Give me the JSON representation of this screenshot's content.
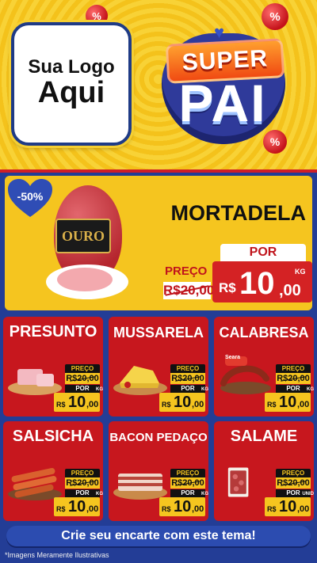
{
  "logo": {
    "line1": "Sua Logo",
    "line2": "Aqui"
  },
  "campaign": {
    "super": "SUPER",
    "pai": "PAI"
  },
  "featured": {
    "discount": "-50%",
    "brand": "OURO",
    "name": "MORTADELA",
    "preco_label": "PREÇO",
    "old_price": "R$20,00",
    "por_label": "POR",
    "currency": "R$",
    "price_int": "10",
    "price_dec": ",00",
    "unit": "KG"
  },
  "products": [
    {
      "name": "PRESUNTO",
      "preco_label": "PREÇO",
      "old_price": "R$20,00",
      "por_label": "POR",
      "currency": "R$",
      "price_int": "10",
      "price_dec": ",00",
      "unit": "KG"
    },
    {
      "name": "MUSSARELA",
      "preco_label": "PREÇO",
      "old_price": "R$20,00",
      "por_label": "POR",
      "currency": "R$",
      "price_int": "10",
      "price_dec": ",00",
      "unit": "KG"
    },
    {
      "name": "CALABRESA",
      "preco_label": "PREÇO",
      "old_price": "R$20,00",
      "por_label": "POR",
      "currency": "R$",
      "price_int": "10",
      "price_dec": ",00",
      "unit": "KG",
      "brand": "Seara"
    },
    {
      "name": "SALSICHA",
      "preco_label": "PREÇO",
      "old_price": "R$20,00",
      "por_label": "POR",
      "currency": "R$",
      "price_int": "10",
      "price_dec": ",00",
      "unit": "KG"
    },
    {
      "name": "BACON PEDAÇO",
      "preco_label": "PREÇO",
      "old_price": "R$20,00",
      "por_label": "POR",
      "currency": "R$",
      "price_int": "10",
      "price_dec": ",00",
      "unit": "KG"
    },
    {
      "name": "SALAME",
      "preco_label": "PREÇO",
      "old_price": "R$20,00",
      "por_label": "POR",
      "currency": "R$",
      "price_int": "10",
      "price_dec": ",00",
      "unit": "UNID"
    }
  ],
  "cta": "Crie seu encarte com este tema!",
  "disclaimer": "*Imagens Meramente Ilustrativas",
  "colors": {
    "red": "#c7171e",
    "yellow": "#f5c51f",
    "blue": "#233d96"
  }
}
